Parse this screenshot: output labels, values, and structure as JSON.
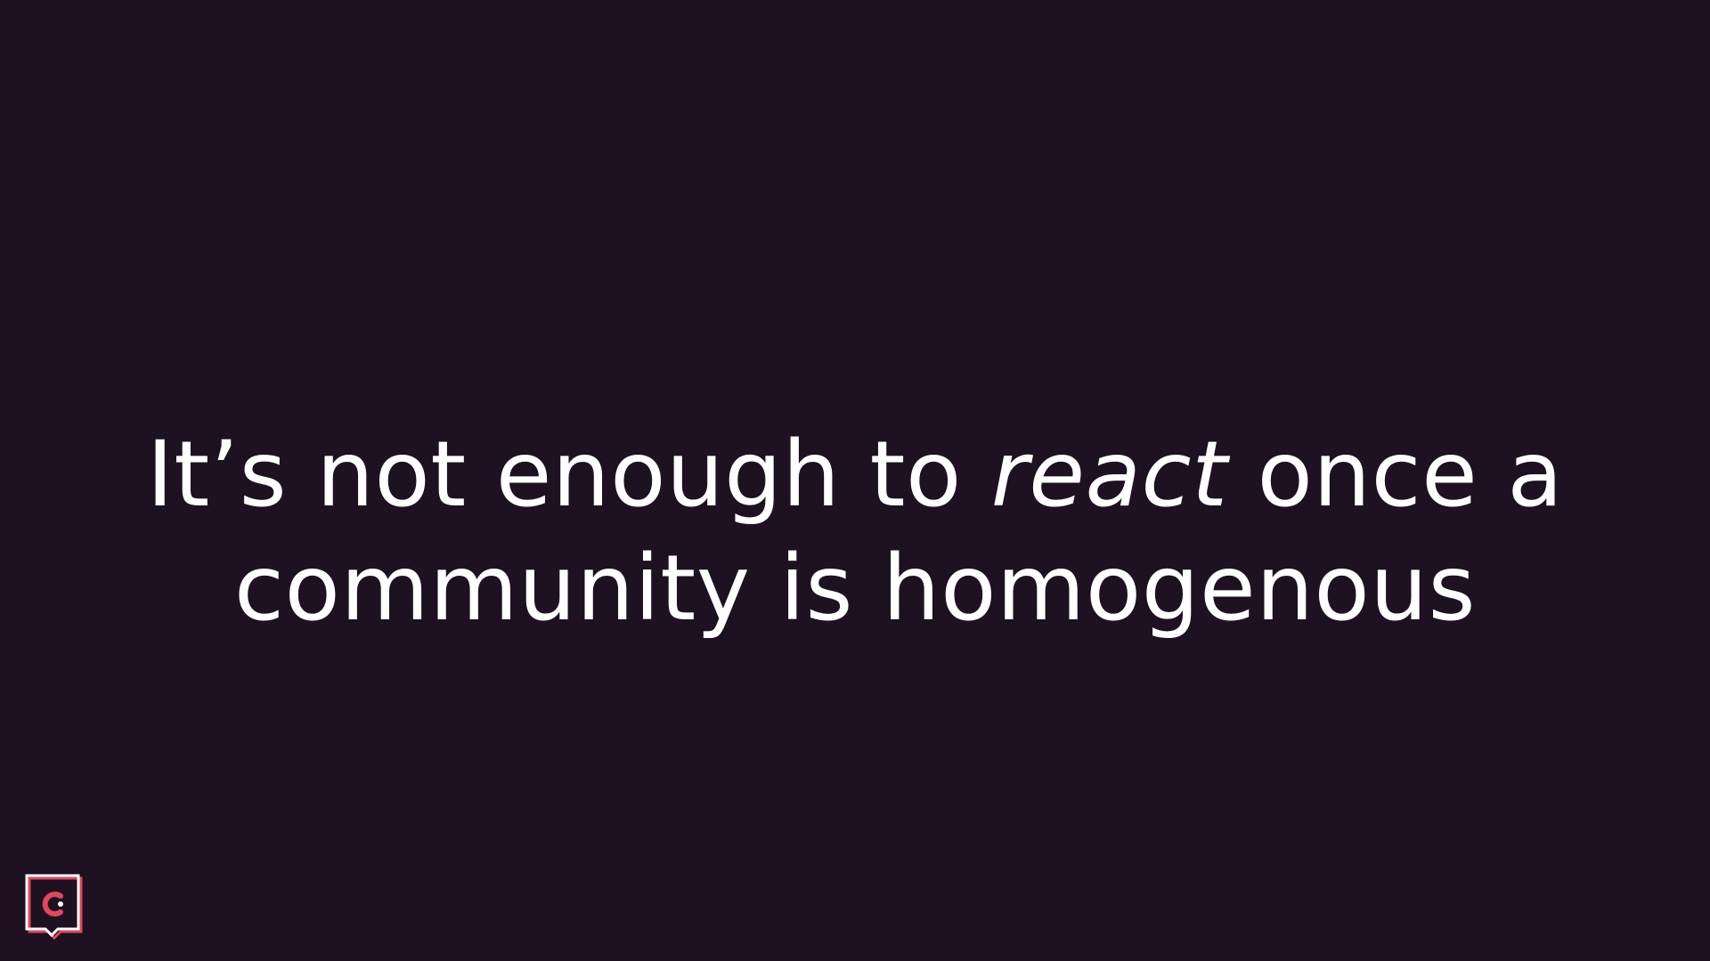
{
  "slide": {
    "statement": {
      "text_before": "It’s not enough to ",
      "emphasis": "react",
      "text_after": " once a community is homogenous"
    },
    "logo": {
      "icon": "c-speech-bubble-logo"
    }
  },
  "colors": {
    "background": "#1d1122",
    "text": "#ffffff",
    "logo_accent": "#e0475b",
    "logo_frame": "#ffffff"
  }
}
